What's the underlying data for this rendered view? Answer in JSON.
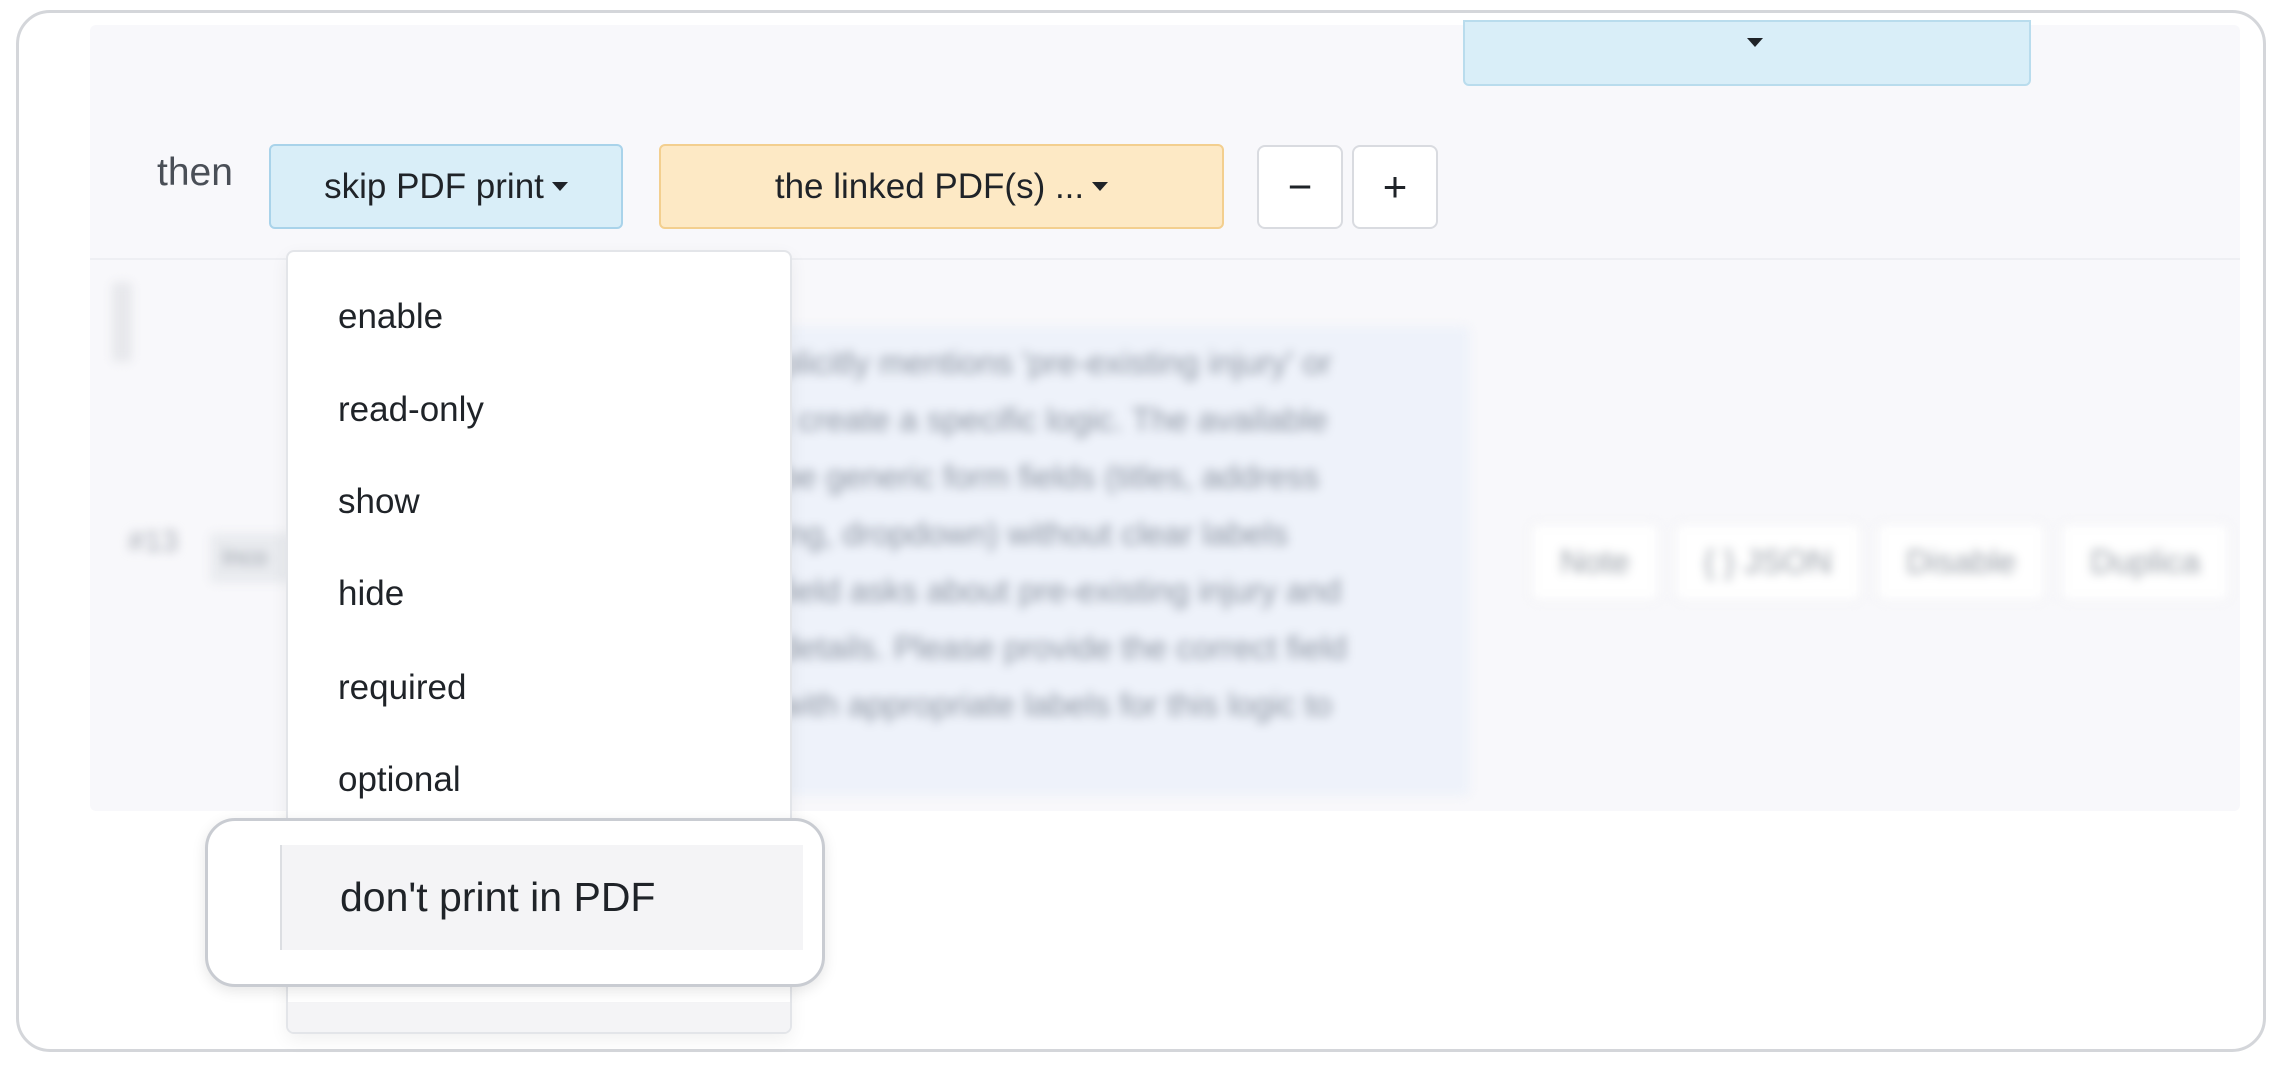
{
  "top_select": {
    "caret_icon": "caret-down-icon"
  },
  "rule": {
    "then_label": "then",
    "action_button": {
      "label": "skip PDF print",
      "caret_icon": "caret-down-icon"
    },
    "target_button": {
      "label": "the linked PDF(s) ...",
      "caret_icon": "caret-down-icon"
    },
    "remove_button": {
      "label": "−"
    },
    "add_button": {
      "label": "+"
    }
  },
  "dropdown": {
    "items": [
      "enable",
      "read-only",
      "show",
      "hide",
      "required",
      "optional"
    ],
    "highlighted_item": "don't print in PDF"
  },
  "background": {
    "rule_number": "#13",
    "badge": "Inco",
    "message_lines": [
      "plicitly mentions 'pre-existing injury' or",
      "t create a specific logic. The available",
      "be generic form fields (titles, address",
      "ing, dropdown) without clear labels",
      "field asks about pre-existing injury and",
      "details. Please provide the correct field",
      "with appropriate labels for this logic to"
    ],
    "toolbar": [
      "Note",
      "{ } JSON",
      "Disable",
      "Duplica"
    ]
  },
  "colors": {
    "action_bg": "#d9eef8",
    "target_bg": "#fde9c5",
    "panel_bg": "#f8f8fb"
  }
}
